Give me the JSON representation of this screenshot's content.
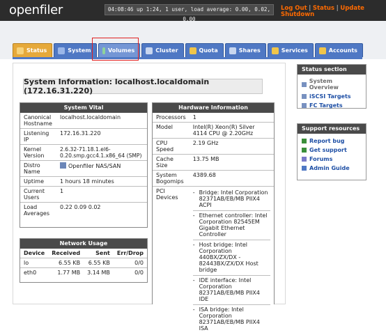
{
  "header": {
    "logo": "openfiler",
    "uptime": "04:08:46 up 1:24, 1 user, load average: 0.00, 0.02, 0.00",
    "links": [
      "Log Out",
      "Status",
      "Update",
      "Shutdown"
    ]
  },
  "tabs": [
    {
      "label": "Status",
      "icon": "status-icon",
      "color": "#e6a93a"
    },
    {
      "label": "System",
      "icon": "system-icon",
      "color": "#9ab6e8"
    },
    {
      "label": "Volumes",
      "icon": "volumes-icon",
      "color": "#8fd39b"
    },
    {
      "label": "Cluster",
      "icon": "cluster-icon",
      "color": "#c8d6ef"
    },
    {
      "label": "Quota",
      "icon": "quota-icon",
      "color": "#f0c54a"
    },
    {
      "label": "Shares",
      "icon": "shares-icon",
      "color": "#c8d6ef"
    },
    {
      "label": "Services",
      "icon": "services-icon",
      "color": "#f0c54a"
    },
    {
      "label": "Accounts",
      "icon": "accounts-icon",
      "color": "#f0c54a"
    }
  ],
  "title": "System Information: localhost.localdomain (172.16.31.220)",
  "system_vital": {
    "heading": "System Vital",
    "rows": [
      {
        "k": "Canonical Hostname",
        "v": "localhost.localdomain"
      },
      {
        "k": "Listening IP",
        "v": "172.16.31.220"
      },
      {
        "k": "Kernel Version",
        "v": "2.6.32-71.18.1.el6-0.20.smp.gcc4.1.x86_64 (SMP)"
      },
      {
        "k": "Distro Name",
        "v": "Openfiler NAS/SAN"
      },
      {
        "k": "Uptime",
        "v": "1 hours 18 minutes"
      },
      {
        "k": "Current Users",
        "v": "1"
      },
      {
        "k": "Load Averages",
        "v": "0.22 0.09 0.02"
      }
    ]
  },
  "network": {
    "heading": "Network Usage",
    "cols": [
      "Device",
      "Received",
      "Sent",
      "Err/Drop"
    ],
    "rows": [
      {
        "dev": "lo",
        "rx": "6.55 KB",
        "tx": "6.55 KB",
        "err": "0/0"
      },
      {
        "dev": "eth0",
        "rx": "1.77 MB",
        "tx": "3.14 MB",
        "err": "0/0"
      }
    ]
  },
  "hardware": {
    "heading": "Hardware Information",
    "rows": [
      {
        "k": "Processors",
        "v": "1"
      },
      {
        "k": "Model",
        "v": "Intel(R) Xeon(R) Silver 4114 CPU @ 2.20GHz"
      },
      {
        "k": "CPU Speed",
        "v": "2.19 GHz"
      },
      {
        "k": "Cache Size",
        "v": "13.75 MB"
      },
      {
        "k": "System Bogomips",
        "v": "4389.68"
      }
    ],
    "pci_label": "PCI Devices",
    "pci": [
      "Bridge: Intel Corporation 82371AB/EB/MB PIIX4 ACPI",
      "Ethernet controller: Intel Corporation 82545EM Gigabit Ethernet Controller",
      "Host bridge: Intel Corporation 440BX/ZX/DX - 82443BX/ZX/DX Host bridge",
      "IDE interface: Intel Corporation 82371AB/EB/MB PIIX4 IDE",
      "ISA bridge: Intel Corporation 82371AB/EB/MB PIIX4 ISA"
    ]
  },
  "status_section": {
    "heading": "Status section",
    "items": [
      "System Overview",
      "iSCSI Targets",
      "FC Targets"
    ]
  },
  "support": {
    "heading": "Support resources",
    "items": [
      "Report bug",
      "Get support",
      "Forums",
      "Admin Guide"
    ]
  }
}
